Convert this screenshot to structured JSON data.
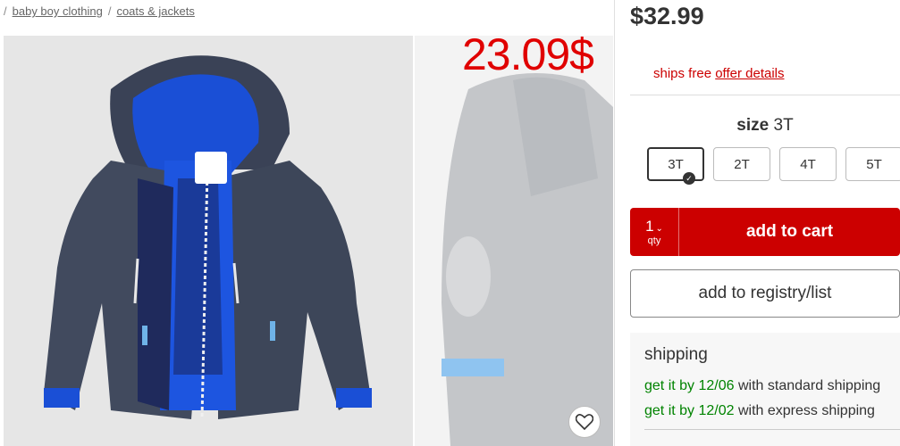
{
  "breadcrumb": {
    "leading_sep": "/",
    "item1": "baby boy clothing",
    "sep": "/",
    "item2": "coats & jackets"
  },
  "overlay_price": "23.09$",
  "product": {
    "price": "$32.99",
    "ships_prefix": "ships free",
    "offer_link": "offer details",
    "size_label": "size",
    "size_selected": "3T",
    "sizes": [
      "3T",
      "2T",
      "4T",
      "5T"
    ]
  },
  "cart": {
    "qty": "1",
    "qty_label": "qty",
    "add_label": "add to cart"
  },
  "registry_label": "add to registry/list",
  "shipping": {
    "title": "shipping",
    "standard_date": "get it by 12/06",
    "standard_suffix": "with standard shipping",
    "express_date": "get it by 12/02",
    "express_suffix": "with express shipping"
  },
  "colors": {
    "accent_red": "#cc0000",
    "overlay_red": "#e00000",
    "ship_green": "#008300"
  },
  "icons": [
    "heart-icon",
    "check-icon",
    "chevron-down-icon"
  ]
}
